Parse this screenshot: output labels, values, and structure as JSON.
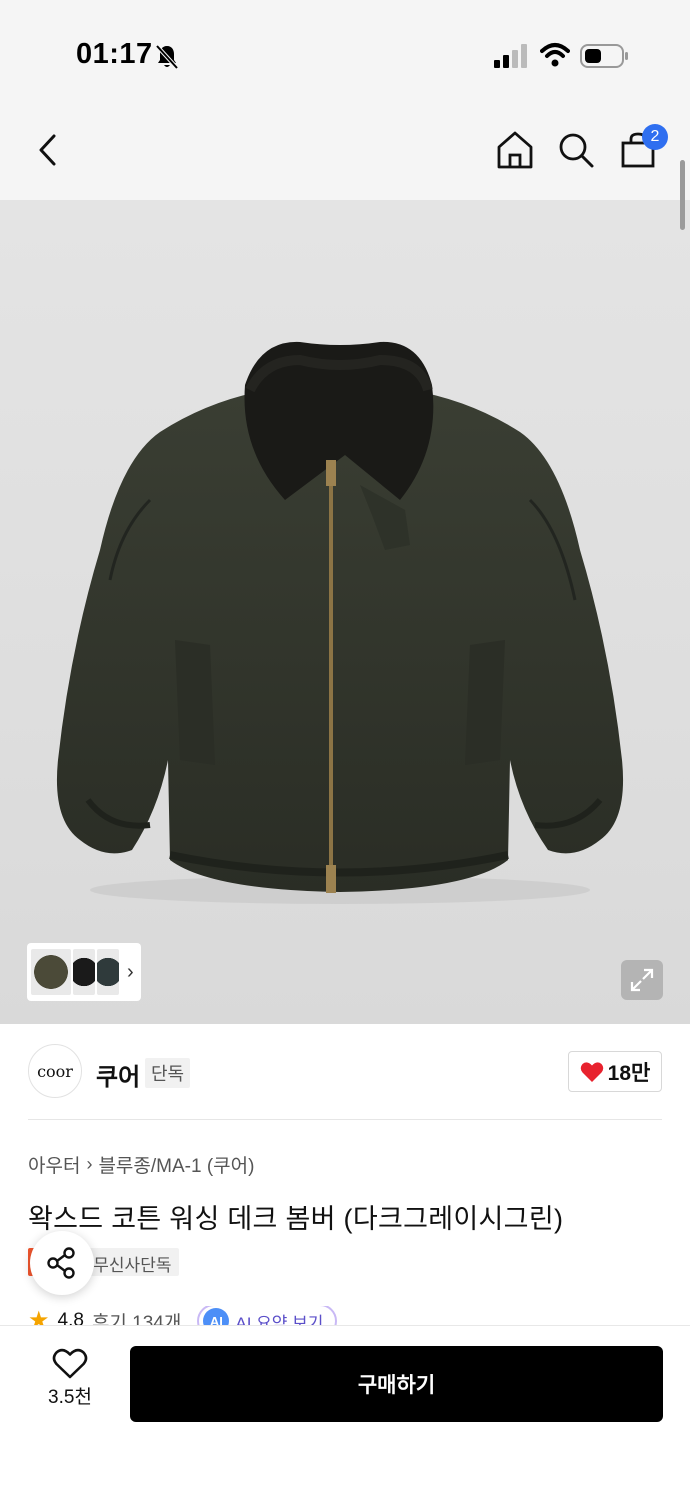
{
  "status_bar": {
    "time": "01:17"
  },
  "nav": {
    "cart_count": "2"
  },
  "gallery": {
    "thumbnail_colors": [
      "#4b4a38",
      "#1a1a1a",
      "#2f3a3b"
    ]
  },
  "brand": {
    "logo_text": "coor",
    "name": "쿠어",
    "tag": "단독",
    "likes": "18만"
  },
  "product": {
    "breadcrumb": [
      "아우터",
      "블루종/MA-1 (쿠어)"
    ],
    "title": "왁스드 코튼 워싱 데크 봄버 (다크그레이시그린)",
    "badges": {
      "sale": "세일",
      "exclusive": "무신사단독"
    },
    "rating": "4.8",
    "reviews": "후기 134개",
    "ai_label": "AI",
    "ai_summary": "AI 요약 보기"
  },
  "bottom_bar": {
    "wish_count": "3.5천",
    "buy_label": "구매하기"
  },
  "colors": {
    "accent_badge": "#f1562e",
    "cart_badge": "#2f6ff0",
    "heart": "#e8222e",
    "buy_button": "#000000"
  }
}
